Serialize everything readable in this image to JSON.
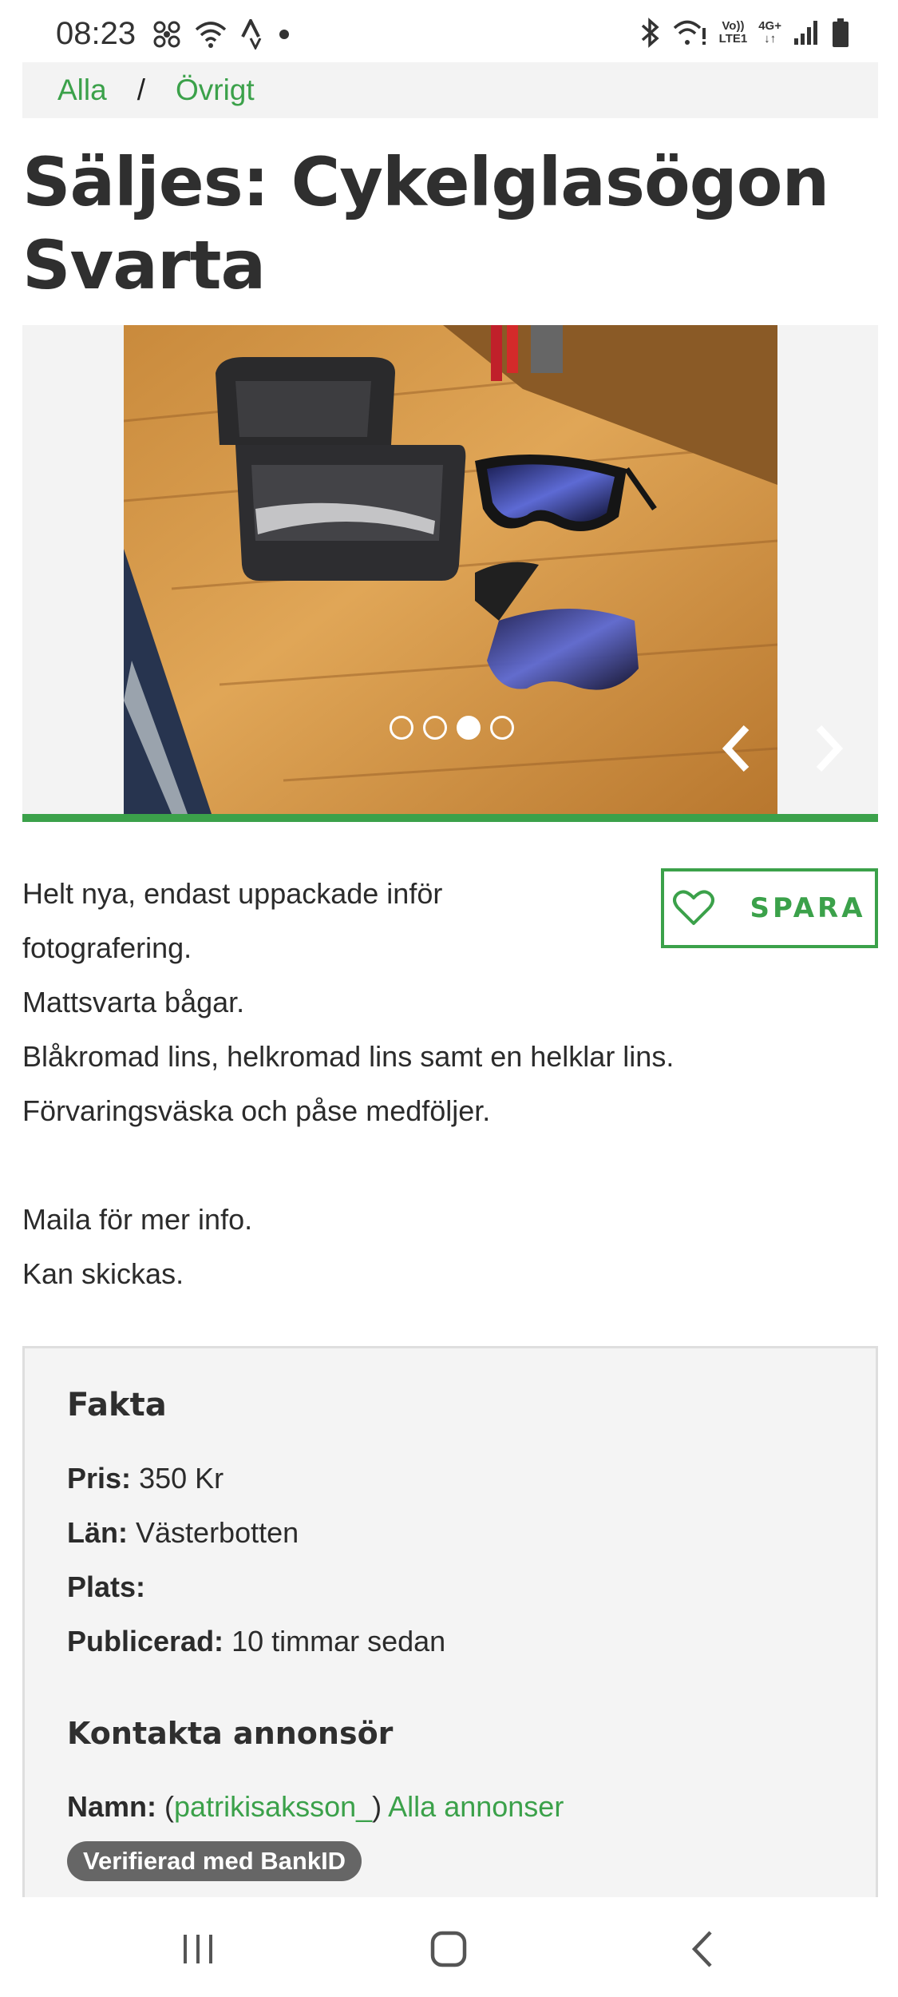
{
  "status_bar": {
    "time": "08:23",
    "left_icons": [
      "fan-icon",
      "wifi-icon",
      "strava-icon",
      "dot-icon"
    ],
    "right_icons": [
      "bluetooth-icon",
      "wifi-alert-icon",
      "volte-icon",
      "4g-icon",
      "signal-icon",
      "battery-icon"
    ],
    "volte_label": "Vo))",
    "lte_label": "LTE1",
    "net_label": "4G+"
  },
  "breadcrumb": {
    "items": [
      "Alla",
      "Övrigt"
    ],
    "separator": "/"
  },
  "page_title": "Säljes: Cykelglasögon Svarta",
  "gallery": {
    "image_count": 4,
    "active_index": 2
  },
  "save_button": {
    "label": "SPARA",
    "icon": "heart-icon"
  },
  "description": [
    "Helt nya, endast uppackade inför",
    "fotografering.",
    "Mattsvarta bågar.",
    "Blåkromad lins, helkromad lins samt en helklar lins.",
    "Förvaringsväska och påse medföljer.",
    "",
    "Maila för mer info.",
    "Kan skickas."
  ],
  "facts": {
    "heading": "Fakta",
    "price_label": "Pris:",
    "price_value": "350 Kr",
    "county_label": "Län:",
    "county_value": "Västerbotten",
    "place_label": "Plats:",
    "place_value": "",
    "published_label": "Publicerad:",
    "published_value": "10 timmar sedan"
  },
  "contact": {
    "heading": "Kontakta annonsör",
    "name_label": "Namn:",
    "open_paren": "(",
    "username": "patrikisaksson_",
    "close_paren": ")",
    "all_ads_link": "Alla annonser",
    "verified_badge": "Verifierad med BankID"
  },
  "colors": {
    "accent": "#3ba14a",
    "badge": "#666666",
    "panel": "#f4f4f4"
  },
  "nav_bar": {
    "icons": [
      "recent-apps-icon",
      "home-icon",
      "back-icon"
    ]
  }
}
